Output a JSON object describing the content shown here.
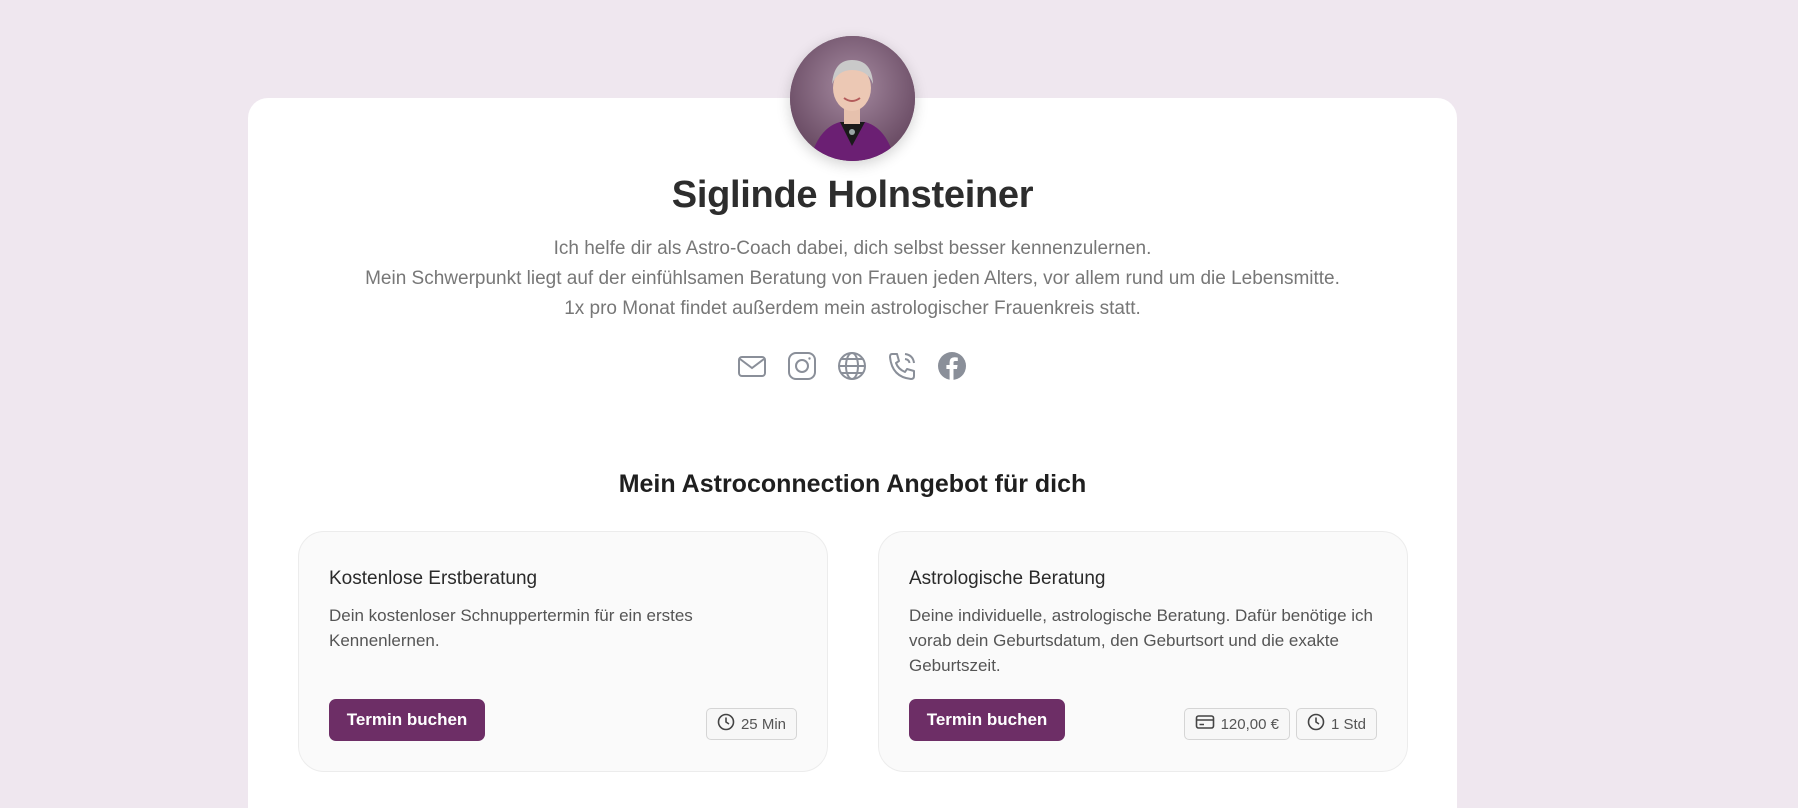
{
  "profile": {
    "name": "Siglinde Holnsteiner",
    "bio_lines": [
      "Ich helfe dir als Astro-Coach dabei, dich selbst besser kennenzulernen.",
      "Mein Schwerpunkt liegt auf der einfühlsamen Beratung von Frauen jeden Alters, vor allem rund um die Lebensmitte.",
      "1x pro Monat findet außerdem mein astrologischer Frauenkreis statt."
    ]
  },
  "social_icons": [
    "mail-icon",
    "instagram-icon",
    "globe-icon",
    "phone-icon",
    "facebook-icon"
  ],
  "offers_section": {
    "title": "Mein Astroconnection Angebot für dich"
  },
  "offers": [
    {
      "title": "Kostenlose Erstberatung",
      "description": "Dein kostenloser Schnuppertermin für ein erstes Kennenlernen.",
      "button_label": "Termin buchen",
      "duration": "25 Min"
    },
    {
      "title": "Astrologische Beratung",
      "description": "Deine individuelle, astrologische Beratung. Dafür benötige ich vorab dein Geburtsdatum, den Geburtsort und die exakte Geburtszeit.",
      "button_label": "Termin buchen",
      "price": "120,00 €",
      "duration": "1 Std"
    }
  ],
  "colors": {
    "page_background": "#efe7ef",
    "accent": "#6d2e66",
    "icon_gray": "#8a8f99"
  }
}
